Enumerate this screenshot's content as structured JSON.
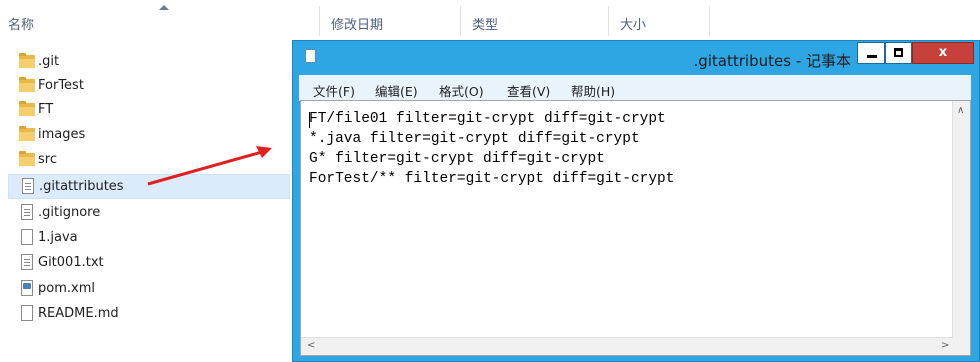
{
  "explorer": {
    "columns": [
      "名称",
      "修改日期",
      "类型",
      "大小"
    ],
    "files": [
      {
        "name": ".git",
        "icon": "folder-icon"
      },
      {
        "name": "ForTest",
        "icon": "folder-icon"
      },
      {
        "name": "FT",
        "icon": "folder-icon"
      },
      {
        "name": "images",
        "icon": "folder-icon"
      },
      {
        "name": "src",
        "icon": "folder-icon"
      },
      {
        "name": ".gitattributes",
        "icon": "text-file-icon",
        "selected": true
      },
      {
        "name": ".gitignore",
        "icon": "text-file-icon"
      },
      {
        "name": "1.java",
        "icon": "blank-file-icon"
      },
      {
        "name": "Git001.txt",
        "icon": "text-file-icon"
      },
      {
        "name": "pom.xml",
        "icon": "xml-file-icon"
      },
      {
        "name": "README.md",
        "icon": "blank-file-icon"
      }
    ]
  },
  "notepad": {
    "title": ".gitattributes - 记事本",
    "close_label": "x",
    "menu": [
      "文件(F)",
      "编辑(E)",
      "格式(O)",
      "查看(V)",
      "帮助(H)"
    ],
    "lines": [
      "FT/file01 filter=git-crypt diff=git-crypt",
      "*.java filter=git-crypt diff=git-crypt",
      "G* filter=git-crypt diff=git-crypt",
      "ForTest/** filter=git-crypt diff=git-crypt"
    ]
  },
  "colors": {
    "window_frame": "#2ea6e3",
    "selection": "#dcebfc",
    "annotation_arrow": "#e02020",
    "close_button": "#c7413c"
  }
}
